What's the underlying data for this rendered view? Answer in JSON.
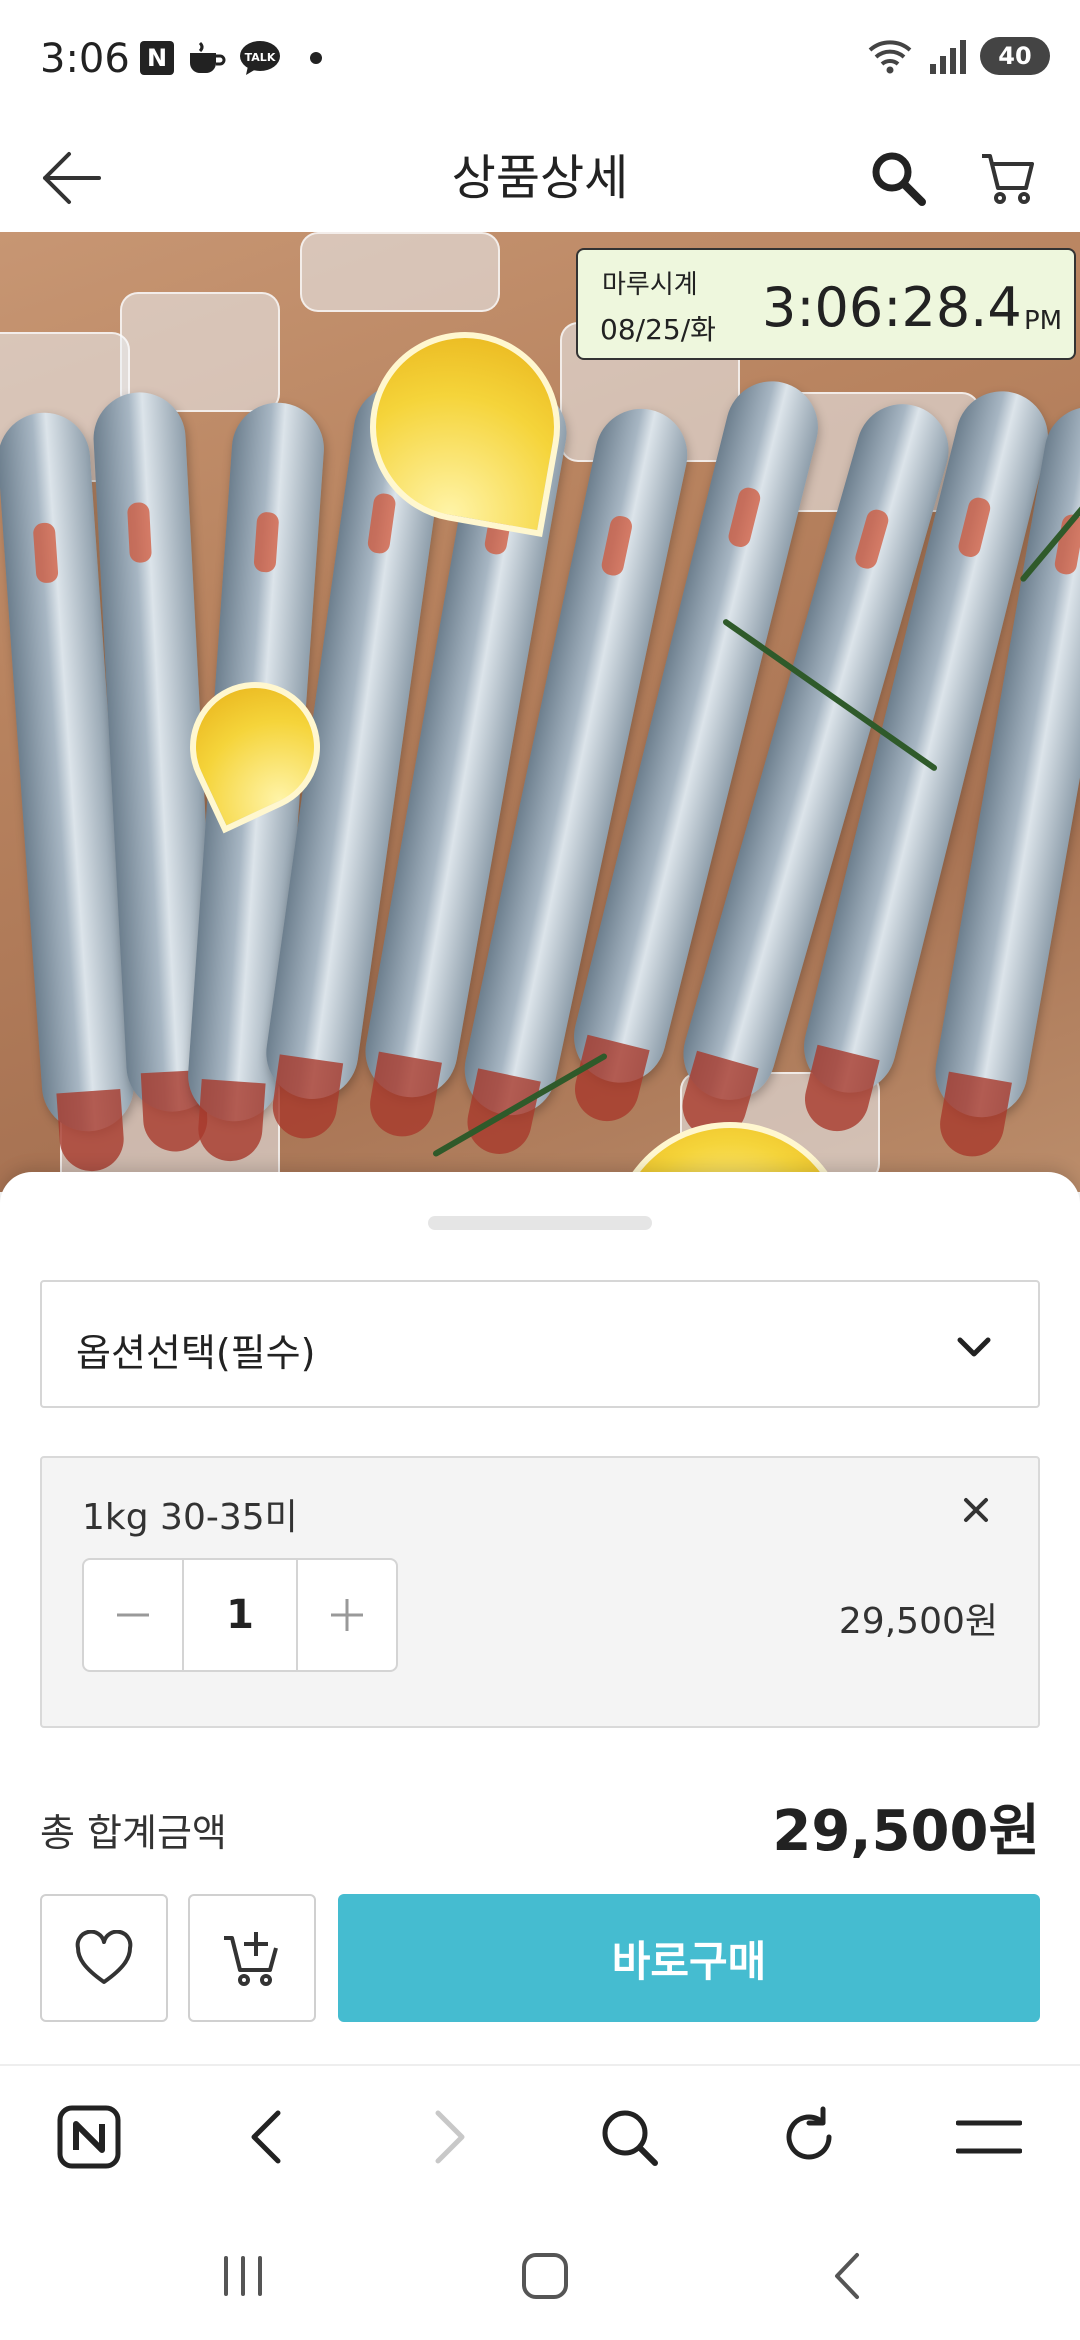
{
  "status_bar": {
    "time": "3:06",
    "battery": "40",
    "notification_icons": [
      "naver-icon",
      "cafe-icon",
      "kakaotalk-icon"
    ],
    "kakaotalk_label": "TALK"
  },
  "header": {
    "title": "상품상세"
  },
  "clock_overlay": {
    "name": "마루시계",
    "date": "08/25/화",
    "time": "3:06:28.4",
    "ampm": "PM"
  },
  "sheet": {
    "option_select_label": "옵션선택(필수)",
    "selected_item": {
      "name": "1kg 30-35미",
      "quantity": "1",
      "price": "29,500원"
    },
    "total_label": "총 합계금액",
    "total_value": "29,500원",
    "buy_label": "바로구매"
  },
  "colors": {
    "accent": "#45bcd0",
    "clock_bg": "#eef7dd"
  }
}
